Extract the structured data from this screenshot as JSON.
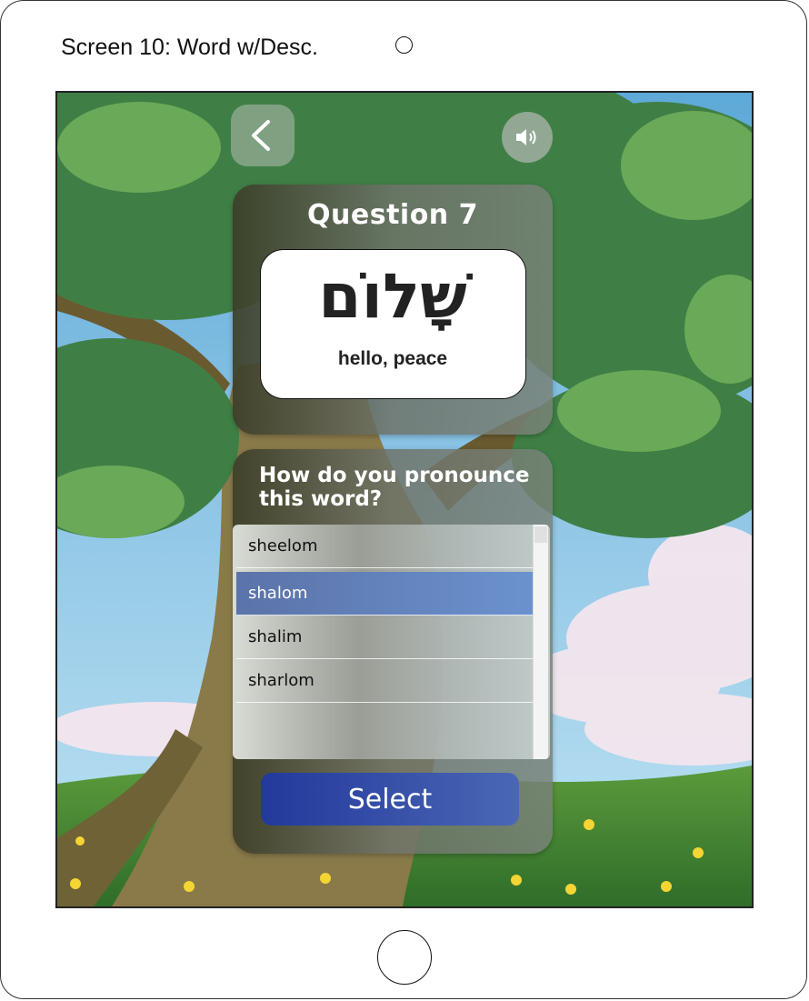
{
  "screen_label": "Screen 10: Word w/Desc.",
  "header": {
    "back_icon": "chevron-left-icon",
    "audio_icon": "speaker-icon"
  },
  "question": {
    "title": "Question 7",
    "word": "שָׁלוֹם",
    "meaning": "hello, peace"
  },
  "answers": {
    "prompt": "How do you pronounce this word?",
    "options": [
      "sheelom",
      "shalom",
      "shalim",
      "sharlom"
    ],
    "selected": "shalom",
    "select_label": "Select"
  },
  "colors": {
    "selected_row": "#5b73a8",
    "select_button": "#23399b"
  }
}
